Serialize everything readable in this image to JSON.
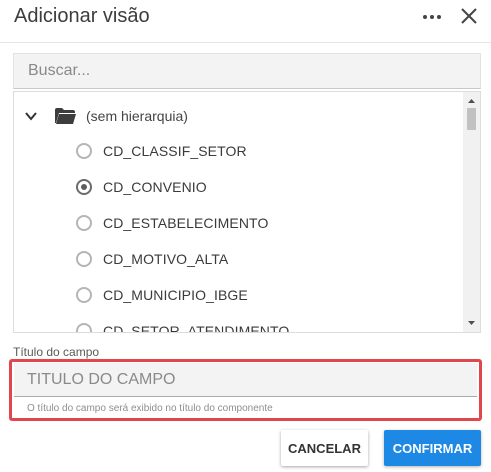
{
  "dialog": {
    "title": "Adicionar visão"
  },
  "search": {
    "placeholder": "Buscar..."
  },
  "tree": {
    "root_label": "(sem hierarquia)",
    "items": [
      {
        "label": "CD_CLASSIF_SETOR",
        "checked": false
      },
      {
        "label": "CD_CONVENIO",
        "checked": true
      },
      {
        "label": "CD_ESTABELECIMENTO",
        "checked": false
      },
      {
        "label": "CD_MOTIVO_ALTA",
        "checked": false
      },
      {
        "label": "CD_MUNICIPIO_IBGE",
        "checked": false
      },
      {
        "label": "CD_SETOR_ATENDIMENTO",
        "checked": false
      }
    ]
  },
  "field": {
    "label": "Título do campo",
    "placeholder": "TITULO DO CAMPO",
    "hint": "O título do campo será exibido no título do componente"
  },
  "buttons": {
    "cancel": "CANCELAR",
    "confirm": "CONFIRMAR"
  },
  "colors": {
    "primary": "#1e88e5",
    "highlight_border": "#e0474c"
  },
  "icons": {
    "more": "more-horizontal-icon",
    "close": "close-icon",
    "expand": "chevron-down-icon",
    "folder": "folder-icon"
  }
}
